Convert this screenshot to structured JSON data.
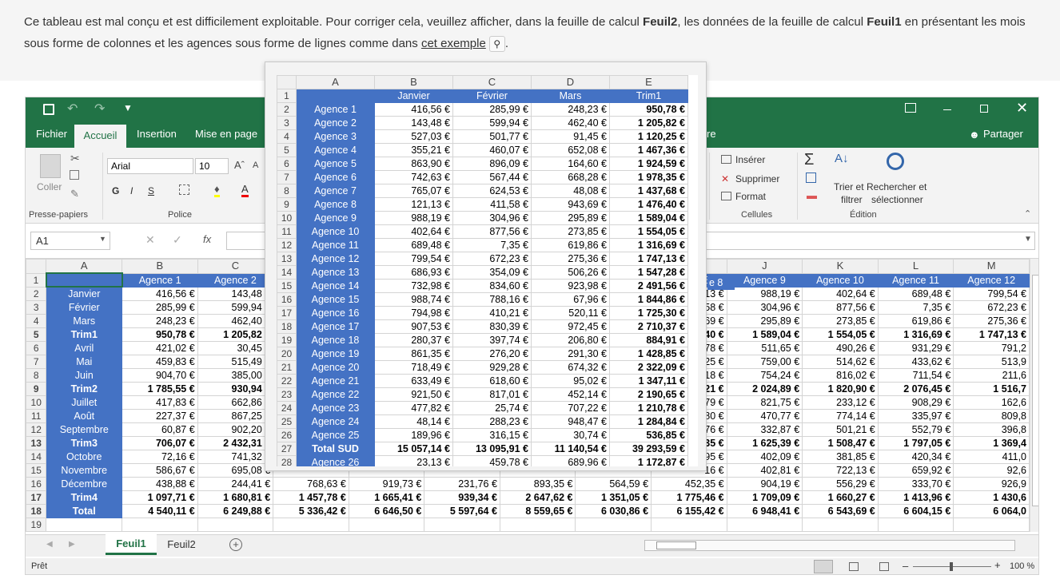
{
  "intro": {
    "p1": "Ce tableau est mal conçu et est difficilement exploitable. Pour corriger cela, veuillez afficher, dans la feuille de calcul ",
    "b1": "Feuil2",
    "p2": ", les données de la feuille de calcul ",
    "b2": "Feuil1",
    "p3": " en présentant les mois sous forme de colonnes et les agences sous forme de lignes comme dans ",
    "link": "cet exemple",
    "p4": "."
  },
  "ribbon": {
    "tabs": [
      "Fichier",
      "Accueil",
      "Insertion",
      "Mise en page"
    ],
    "tab_extra": "re",
    "share": "Partager",
    "coller": "Coller",
    "presse": "Presse-papiers",
    "font_name": "Arial",
    "font_size": "10",
    "police": "Police",
    "inserer": "Insérer",
    "supprimer": "Supprimer",
    "format": "Format",
    "cellules": "Cellules",
    "trier1": "Trier et",
    "trier2": "filtrer",
    "rech1": "Rechercher et",
    "rech2": "sélectionner",
    "edition": "Édition",
    "bold": "G",
    "italic": "I",
    "underline": "S"
  },
  "namebox": "A1",
  "sheets": {
    "tabs": [
      "Feuil1",
      "Feuil2"
    ],
    "status": "Prêt",
    "zoom": "100 %"
  },
  "grid": {
    "cols": [
      "A",
      "B",
      "C",
      "D",
      "E",
      "F",
      "G",
      "H",
      "I",
      "J",
      "K",
      "L",
      "M"
    ],
    "hidden_header": "e 8",
    "header": [
      "",
      "Agence 1",
      "Agence 2",
      "Agence 3",
      "Agence 4",
      "Agence 5",
      "Agence 6",
      "Agence 7",
      "Agence 8",
      "Agence 9",
      "Agence 10",
      "Agence 11",
      "Agence 12"
    ],
    "rows": [
      [
        "Janvier",
        "416,56 €",
        "143,48 €",
        "527,03 €",
        "355,21 €",
        "863,90 €",
        "742,63 €",
        "765,07 €",
        "121,13 €",
        "988,19 €",
        "402,64 €",
        "689,48 €",
        "799,54 €"
      ],
      [
        "Février",
        "285,99 €",
        "599,94 €",
        "501,77 €",
        "460,07 €",
        "896,09 €",
        "567,44 €",
        "624,53 €",
        "411,58 €",
        "304,96 €",
        "877,56 €",
        "7,35 €",
        "672,23 €"
      ],
      [
        "Mars",
        "248,23 €",
        "462,40 €",
        "91,45 €",
        "652,08 €",
        "164,60 €",
        "668,28 €",
        "48,08 €",
        "943,69 €",
        "295,89 €",
        "273,85 €",
        "619,86 €",
        "275,36 €"
      ],
      [
        "Trim1",
        "950,78 €",
        "1 205,82 €",
        "1 120,25 €",
        "1 467,36 €",
        "1 924,59 €",
        "1 978,35 €",
        "1 437,68 €",
        "1 476,40 €",
        "1 589,04 €",
        "1 554,05 €",
        "1 316,69 €",
        "1 747,13 €"
      ],
      [
        "Avril",
        "421,02 €",
        "30,45 €",
        "",
        "",
        "",
        "",
        "",
        "78 €",
        "511,65 €",
        "490,26 €",
        "931,29 €",
        "791,2"
      ],
      [
        "Mai",
        "459,83 €",
        "515,49 €",
        "",
        "",
        "",
        "",
        "",
        "25 €",
        "759,00 €",
        "514,62 €",
        "433,62 €",
        "513,9"
      ],
      [
        "Juin",
        "904,70 €",
        "385,00 €",
        "",
        "",
        "",
        "",
        "",
        "18 €",
        "754,24 €",
        "816,02 €",
        "711,54 €",
        "211,6"
      ],
      [
        "Trim2",
        "1 785,55 €",
        "930,94 €",
        "",
        "",
        "",
        "",
        "",
        "21 €",
        "2 024,89 €",
        "1 820,90 €",
        "2 076,45 €",
        "1 516,7"
      ],
      [
        "Juillet",
        "417,83 €",
        "662,86 €",
        "",
        "",
        "",
        "",
        "",
        "79 €",
        "821,75 €",
        "233,12 €",
        "908,29 €",
        "162,6"
      ],
      [
        "Août",
        "227,37 €",
        "867,25 €",
        "",
        "",
        "",
        "",
        "",
        "80 €",
        "470,77 €",
        "774,14 €",
        "335,97 €",
        "809,8"
      ],
      [
        "Septembre",
        "60,87 €",
        "902,20 €",
        "",
        "",
        "",
        "",
        "",
        "76 €",
        "332,87 €",
        "501,21 €",
        "552,79 €",
        "396,8"
      ],
      [
        "Trim3",
        "706,07 €",
        "2 432,31 €",
        "",
        "",
        "",
        "",
        "",
        "35 €",
        "1 625,39 €",
        "1 508,47 €",
        "1 797,05 €",
        "1 369,4"
      ],
      [
        "Octobre",
        "72,16 €",
        "741,32 €",
        "",
        "",
        "",
        "",
        "",
        "95 €",
        "402,09 €",
        "381,85 €",
        "420,34 €",
        "411,0"
      ],
      [
        "Novembre",
        "586,67 €",
        "695,08 €",
        "",
        "",
        "",
        "",
        "",
        "16 €",
        "402,81 €",
        "722,13 €",
        "659,92 €",
        "92,6"
      ],
      [
        "Décembre",
        "438,88 €",
        "244,41 €",
        "768,63 €",
        "919,73 €",
        "231,76 €",
        "893,35 €",
        "564,59 €",
        "452,35 €",
        "904,19 €",
        "556,29 €",
        "333,70 €",
        "926,9"
      ],
      [
        "Trim4",
        "1 097,71 €",
        "1 680,81 €",
        "1 457,78 €",
        "1 665,41 €",
        "939,34 €",
        "2 647,62 €",
        "1 351,05 €",
        "1 775,46 €",
        "1 709,09 €",
        "1 660,27 €",
        "1 413,96 €",
        "1 430,6"
      ],
      [
        "Total",
        "4 540,11 €",
        "6 249,88 €",
        "5 336,42 €",
        "6 646,50 €",
        "5 597,64 €",
        "8 559,65 €",
        "6 030,86 €",
        "6 155,42 €",
        "6 948,41 €",
        "6 543,69 €",
        "6 604,15 €",
        "6 064,0"
      ]
    ]
  },
  "example": {
    "cols": [
      "A",
      "B",
      "C",
      "D",
      "E"
    ],
    "header": [
      "",
      "Janvier",
      "Février",
      "Mars",
      "Trim1"
    ],
    "rows": [
      [
        "Agence 1",
        "416,56 €",
        "285,99 €",
        "248,23 €",
        "950,78 €"
      ],
      [
        "Agence 2",
        "143,48 €",
        "599,94 €",
        "462,40 €",
        "1 205,82 €"
      ],
      [
        "Agence 3",
        "527,03 €",
        "501,77 €",
        "91,45 €",
        "1 120,25 €"
      ],
      [
        "Agence 4",
        "355,21 €",
        "460,07 €",
        "652,08 €",
        "1 467,36 €"
      ],
      [
        "Agence 5",
        "863,90 €",
        "896,09 €",
        "164,60 €",
        "1 924,59 €"
      ],
      [
        "Agence 6",
        "742,63 €",
        "567,44 €",
        "668,28 €",
        "1 978,35 €"
      ],
      [
        "Agence 7",
        "765,07 €",
        "624,53 €",
        "48,08 €",
        "1 437,68 €"
      ],
      [
        "Agence 8",
        "121,13 €",
        "411,58 €",
        "943,69 €",
        "1 476,40 €"
      ],
      [
        "Agence 9",
        "988,19 €",
        "304,96 €",
        "295,89 €",
        "1 589,04 €"
      ],
      [
        "Agence 10",
        "402,64 €",
        "877,56 €",
        "273,85 €",
        "1 554,05 €"
      ],
      [
        "Agence 11",
        "689,48 €",
        "7,35 €",
        "619,86 €",
        "1 316,69 €"
      ],
      [
        "Agence 12",
        "799,54 €",
        "672,23 €",
        "275,36 €",
        "1 747,13 €"
      ],
      [
        "Agence 13",
        "686,93 €",
        "354,09 €",
        "506,26 €",
        "1 547,28 €"
      ],
      [
        "Agence 14",
        "732,98 €",
        "834,60 €",
        "923,98 €",
        "2 491,56 €"
      ],
      [
        "Agence 15",
        "988,74 €",
        "788,16 €",
        "67,96 €",
        "1 844,86 €"
      ],
      [
        "Agence 16",
        "794,98 €",
        "410,21 €",
        "520,11 €",
        "1 725,30 €"
      ],
      [
        "Agence 17",
        "907,53 €",
        "830,39 €",
        "972,45 €",
        "2 710,37 €"
      ],
      [
        "Agence 18",
        "280,37 €",
        "397,74 €",
        "206,80 €",
        "884,91 €"
      ],
      [
        "Agence 19",
        "861,35 €",
        "276,20 €",
        "291,30 €",
        "1 428,85 €"
      ],
      [
        "Agence 20",
        "718,49 €",
        "929,28 €",
        "674,32 €",
        "2 322,09 €"
      ],
      [
        "Agence 21",
        "633,49 €",
        "618,60 €",
        "95,02 €",
        "1 347,11 €"
      ],
      [
        "Agence 22",
        "921,50 €",
        "817,01 €",
        "452,14 €",
        "2 190,65 €"
      ],
      [
        "Agence 23",
        "477,82 €",
        "25,74 €",
        "707,22 €",
        "1 210,78 €"
      ],
      [
        "Agence 24",
        "48,14 €",
        "288,23 €",
        "948,47 €",
        "1 284,84 €"
      ],
      [
        "Agence 25",
        "189,96 €",
        "316,15 €",
        "30,74 €",
        "536,85 €"
      ],
      [
        "Total SUD",
        "15 057,14 €",
        "13 095,91 €",
        "11 140,54 €",
        "39 293,59 €"
      ],
      [
        "Agence 26",
        "23,13 €",
        "459,78 €",
        "689,96 €",
        "1 172,87 €"
      ]
    ]
  }
}
